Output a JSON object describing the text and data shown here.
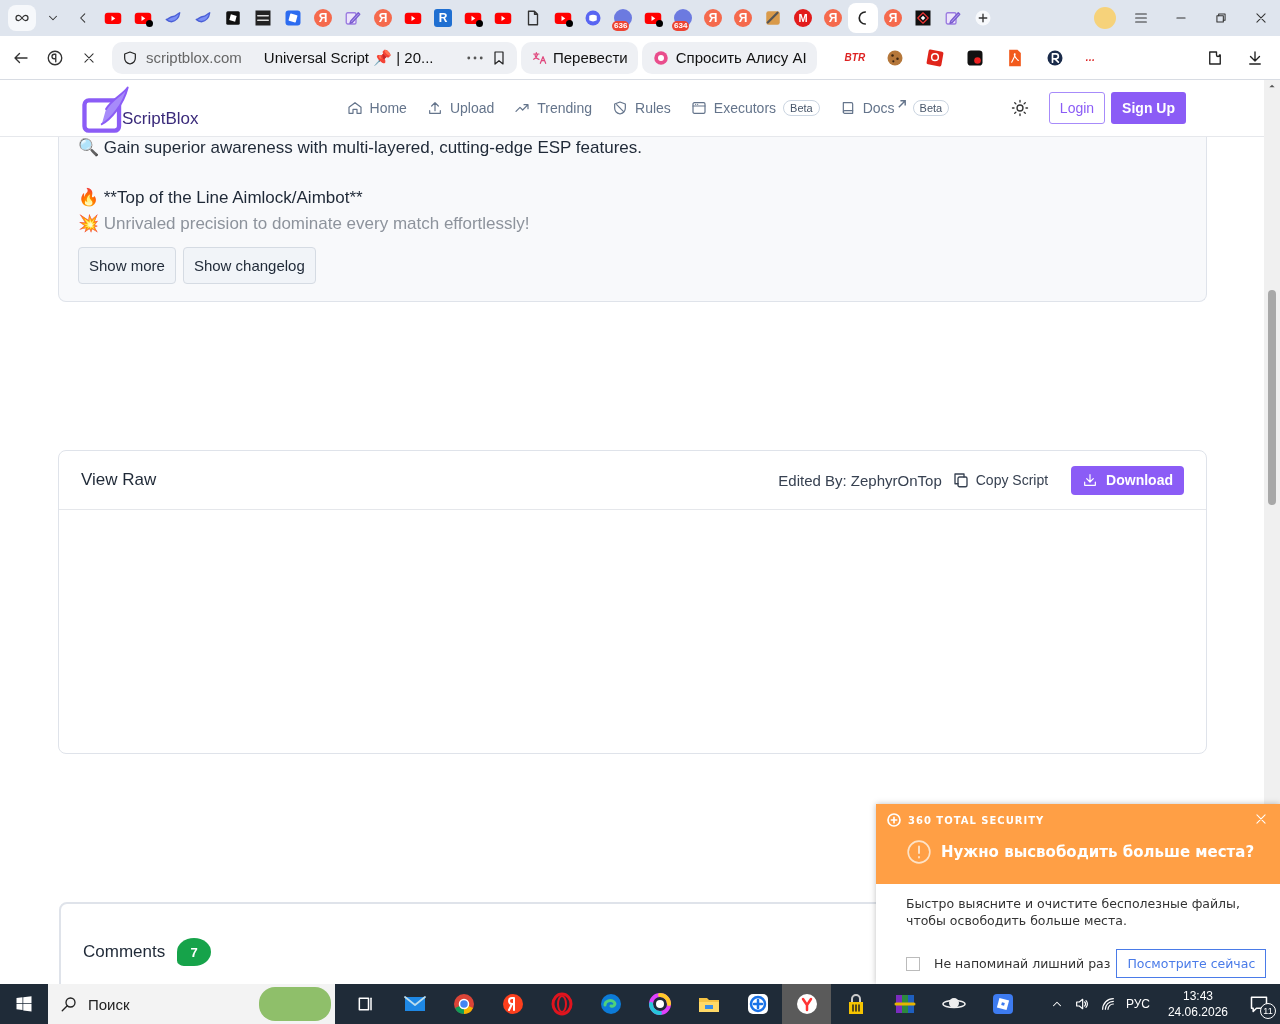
{
  "browser": {
    "tabs": [
      {
        "kind": "youtube",
        "dot": false,
        "selected": false
      },
      {
        "kind": "youtube",
        "dot": true,
        "selected": false
      },
      {
        "kind": "bird",
        "dot": false,
        "selected": false
      },
      {
        "kind": "bird",
        "dot": false,
        "selected": false
      },
      {
        "kind": "black",
        "dot": false,
        "selected": false
      },
      {
        "kind": "dark",
        "dot": false,
        "selected": false
      },
      {
        "kind": "tile",
        "dot": false,
        "selected": false
      },
      {
        "kind": "ya",
        "glyph": "Я",
        "dot": false,
        "selected": false
      },
      {
        "kind": "pen",
        "dot": false,
        "selected": false
      },
      {
        "kind": "ya",
        "glyph": "Я",
        "dot": false,
        "selected": false
      },
      {
        "kind": "youtube",
        "dot": false,
        "selected": false
      },
      {
        "kind": "letterbox",
        "glyph": "R",
        "dot": false,
        "selected": false
      },
      {
        "kind": "youtube",
        "dot": true,
        "selected": false
      },
      {
        "kind": "youtube",
        "dot": false,
        "selected": false
      },
      {
        "kind": "doc",
        "dot": false,
        "selected": false
      },
      {
        "kind": "youtube",
        "dot": true,
        "selected": false
      },
      {
        "kind": "discord",
        "dot": false,
        "selected": false
      },
      {
        "kind": "avatar",
        "badge": "636",
        "dot": false,
        "selected": false
      },
      {
        "kind": "youtube",
        "dot": true,
        "selected": false
      },
      {
        "kind": "avatar",
        "badge": "634",
        "dot": false,
        "selected": false
      },
      {
        "kind": "ya",
        "glyph": "Я",
        "dot": false,
        "selected": false
      },
      {
        "kind": "ya",
        "glyph": "Я",
        "dot": false,
        "selected": false
      },
      {
        "kind": "misc",
        "dot": false,
        "selected": false
      },
      {
        "kind": "lettercircle",
        "glyph": "M",
        "dot": false,
        "selected": false
      },
      {
        "kind": "ya",
        "glyph": "Я",
        "dot": false,
        "selected": false
      },
      {
        "kind": "spinner",
        "dot": false,
        "selected": true
      },
      {
        "kind": "ya",
        "glyph": "Я",
        "dot": false,
        "selected": false
      },
      {
        "kind": "diamond",
        "dot": false,
        "selected": false
      },
      {
        "kind": "pen",
        "dot": false,
        "selected": false
      }
    ],
    "address": "scriptblox.com",
    "page_title": "Universal Script 📌 | 20...",
    "translate": "Перевести",
    "ask_alice": "Спросить Алису AI",
    "bookmarks": [
      {
        "kind": "text",
        "glyph": "BTR"
      },
      {
        "kind": "cookie"
      },
      {
        "kind": "redsquare"
      },
      {
        "kind": "dice"
      },
      {
        "kind": "pdf"
      },
      {
        "kind": "rcircle"
      },
      {
        "kind": "text",
        "glyph": "…"
      }
    ]
  },
  "site": {
    "logo": "ScriptBlox",
    "nav": [
      {
        "kind": "home",
        "label": "Home"
      },
      {
        "kind": "upload",
        "label": "Upload"
      },
      {
        "kind": "trending",
        "label": "Trending"
      },
      {
        "kind": "shield",
        "label": "Rules"
      },
      {
        "kind": "window",
        "label": "Executors",
        "badge": "Beta"
      },
      {
        "kind": "book",
        "label": "Docs",
        "external": true,
        "badge": "Beta"
      }
    ],
    "login": "Login",
    "signup": "Sign Up"
  },
  "description": {
    "lines": [
      {
        "emoji": "🔍",
        "text": "Gain superior awareness with multi-layered, cutting-edge ESP features.",
        "faded": false
      },
      {
        "emoji": "🔥",
        "text": "**Top of the Line Aimlock/Aimbot**",
        "faded": false
      },
      {
        "emoji": "💥",
        "text": "Unrivaled precision to dominate every match effortlessly!",
        "faded": true
      }
    ],
    "buttons": [
      "Show more",
      "Show changelog"
    ]
  },
  "raw": {
    "title": "View Raw",
    "edited_by": "Edited By: ZephyrOnTop",
    "copy": "Copy Script",
    "download": "Download"
  },
  "comments": {
    "title": "Comments",
    "count": "7"
  },
  "popup": {
    "brand": "360 TOTAL SECURITY",
    "title": "Нужно высвободить больше места?",
    "body": "Быстро выясните и очистите бесполезные файлы, чтобы освободить больше места.",
    "checkbox": {
      "label": "Не напоминай лишний раз",
      "checked": false
    },
    "button": "Посмотрите сейчас"
  },
  "taskbar": {
    "search": "Поиск",
    "apps": [
      {
        "kind": "taskview"
      },
      {
        "kind": "mail"
      },
      {
        "kind": "chrome"
      },
      {
        "kind": "yandex"
      },
      {
        "kind": "opera"
      },
      {
        "kind": "edge"
      },
      {
        "kind": "colors"
      },
      {
        "kind": "folder"
      },
      {
        "kind": "helper"
      },
      {
        "kind": "ybrowser"
      },
      {
        "kind": "lock"
      },
      {
        "kind": "archive"
      },
      {
        "kind": "planet"
      },
      {
        "kind": "roblox"
      }
    ],
    "lang": "РУС",
    "time": "13:43",
    "date": "24.06.2026",
    "notifications": "11"
  }
}
